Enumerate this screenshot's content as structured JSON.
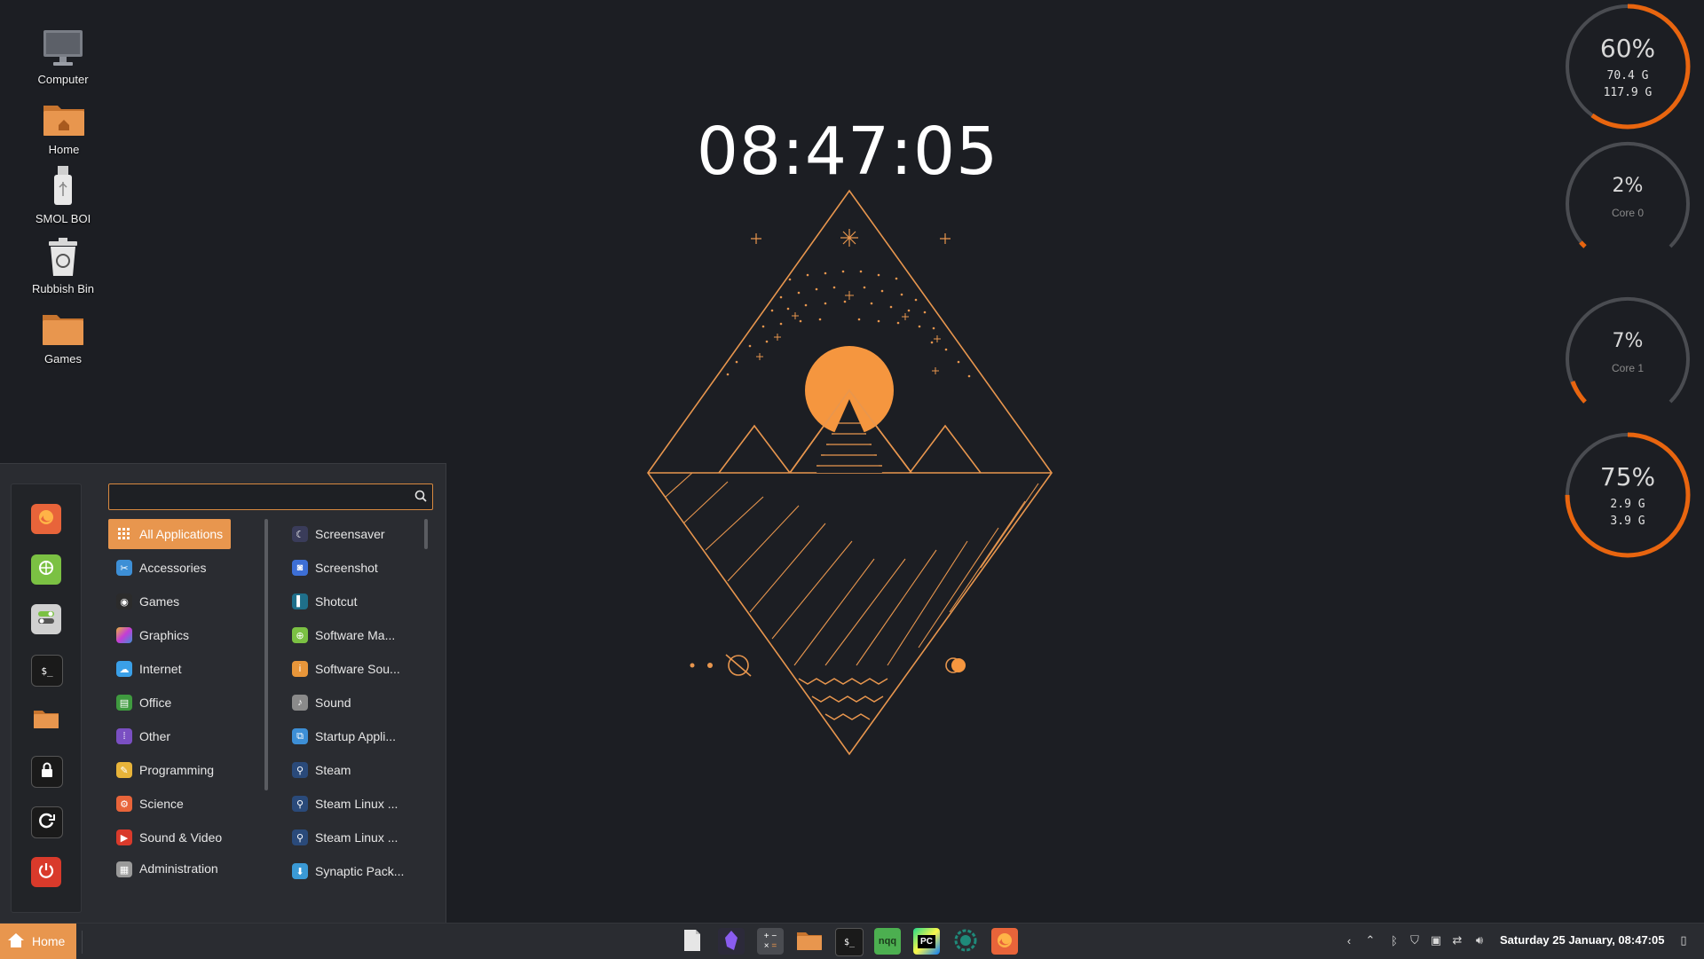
{
  "desktop": {
    "icons": [
      {
        "label": "Computer",
        "icon": "monitor-icon"
      },
      {
        "label": "Home",
        "icon": "home-folder-icon"
      },
      {
        "label": "SMOL BOI",
        "icon": "usb-drive-icon"
      },
      {
        "label": "Rubbish Bin",
        "icon": "trash-icon"
      },
      {
        "label": "Games",
        "icon": "folder-icon"
      }
    ],
    "clock": "08:47:05"
  },
  "gauges": [
    {
      "percent": "60%",
      "line1": "70.4 G",
      "line2": "117.9 G",
      "fraction": 0.6
    },
    {
      "percent": "2%",
      "label": "Core 0",
      "fraction": 0.02
    },
    {
      "percent": "7%",
      "label": "Core 1",
      "fraction": 0.07
    },
    {
      "percent": "75%",
      "line1": "2.9 G",
      "line2": "3.9 G",
      "fraction": 0.75
    }
  ],
  "menu": {
    "search": {
      "value": "",
      "placeholder": ""
    },
    "favorites": [
      {
        "name": "firefox-icon",
        "color": "#e8643a"
      },
      {
        "name": "software-manager-icon",
        "color": "#7bc143"
      },
      {
        "name": "settings-toggle-icon",
        "color": "#d0d0d0"
      },
      {
        "name": "terminal-icon",
        "color": "#1a1a1a"
      },
      {
        "name": "files-folder-icon",
        "color": "#e8964e"
      },
      {
        "name": "lock-screen-icon",
        "color": "#1a1a1a"
      },
      {
        "name": "logout-icon",
        "color": "#1a1a1a"
      },
      {
        "name": "power-icon",
        "color": "#d93a2b"
      }
    ],
    "categories": [
      {
        "label": "All Applications",
        "color": "#e8964e"
      },
      {
        "label": "Accessories",
        "color": "#3d8fd6"
      },
      {
        "label": "Games",
        "color": "#2b2b2b"
      },
      {
        "label": "Graphics",
        "color": "#c43dd6"
      },
      {
        "label": "Internet",
        "color": "#3aa0e8"
      },
      {
        "label": "Office",
        "color": "#3f9a3f"
      },
      {
        "label": "Other",
        "color": "#7a4fc2"
      },
      {
        "label": "Programming",
        "color": "#e8b43a"
      },
      {
        "label": "Science",
        "color": "#e8643a"
      },
      {
        "label": "Sound & Video",
        "color": "#d93a2b"
      },
      {
        "label": "Administration",
        "color": "#9a9a9a"
      }
    ],
    "apps": [
      {
        "label": "Screensaver",
        "color": "#3a3c5a"
      },
      {
        "label": "Screenshot",
        "color": "#3d6fd6"
      },
      {
        "label": "Shotcut",
        "color": "#1f6f8a"
      },
      {
        "label": "Software Ma...",
        "color": "#7bc143"
      },
      {
        "label": "Software Sou...",
        "color": "#e8963a"
      },
      {
        "label": "Sound",
        "color": "#8a8a8a"
      },
      {
        "label": "Startup Appli...",
        "color": "#3d8fd6"
      },
      {
        "label": "Steam",
        "color": "#2a4a7a"
      },
      {
        "label": "Steam Linux ...",
        "color": "#2a4a7a"
      },
      {
        "label": "Steam Linux ...",
        "color": "#2a4a7a"
      },
      {
        "label": "Synaptic Pack...",
        "color": "#3a9ad6"
      }
    ]
  },
  "taskbar": {
    "home_label": "Home",
    "apps": [
      {
        "name": "text-editor-icon",
        "color": "#d8d8d8"
      },
      {
        "name": "obsidian-icon",
        "color": "#5a3fa0"
      },
      {
        "name": "calculator-icon",
        "color": "#4a4c51"
      },
      {
        "name": "file-manager-icon",
        "color": "#e8964e"
      },
      {
        "name": "terminal-icon",
        "color": "#1a1a1a"
      },
      {
        "name": "nqq-editor-icon",
        "color": "#4caf50"
      },
      {
        "name": "pycharm-icon",
        "color": "#21d789"
      },
      {
        "name": "timeshift-icon",
        "color": "#1a1a1a"
      },
      {
        "name": "firefox-icon",
        "color": "#e8643a"
      }
    ],
    "nqq_text": "nqq",
    "pc_text": "PC",
    "clock": "Saturday 25 January, 08:47:05"
  },
  "colors": {
    "accent": "#e8964e",
    "gauge_track": "#4a4c51",
    "gauge_fill": "#e8650f"
  }
}
